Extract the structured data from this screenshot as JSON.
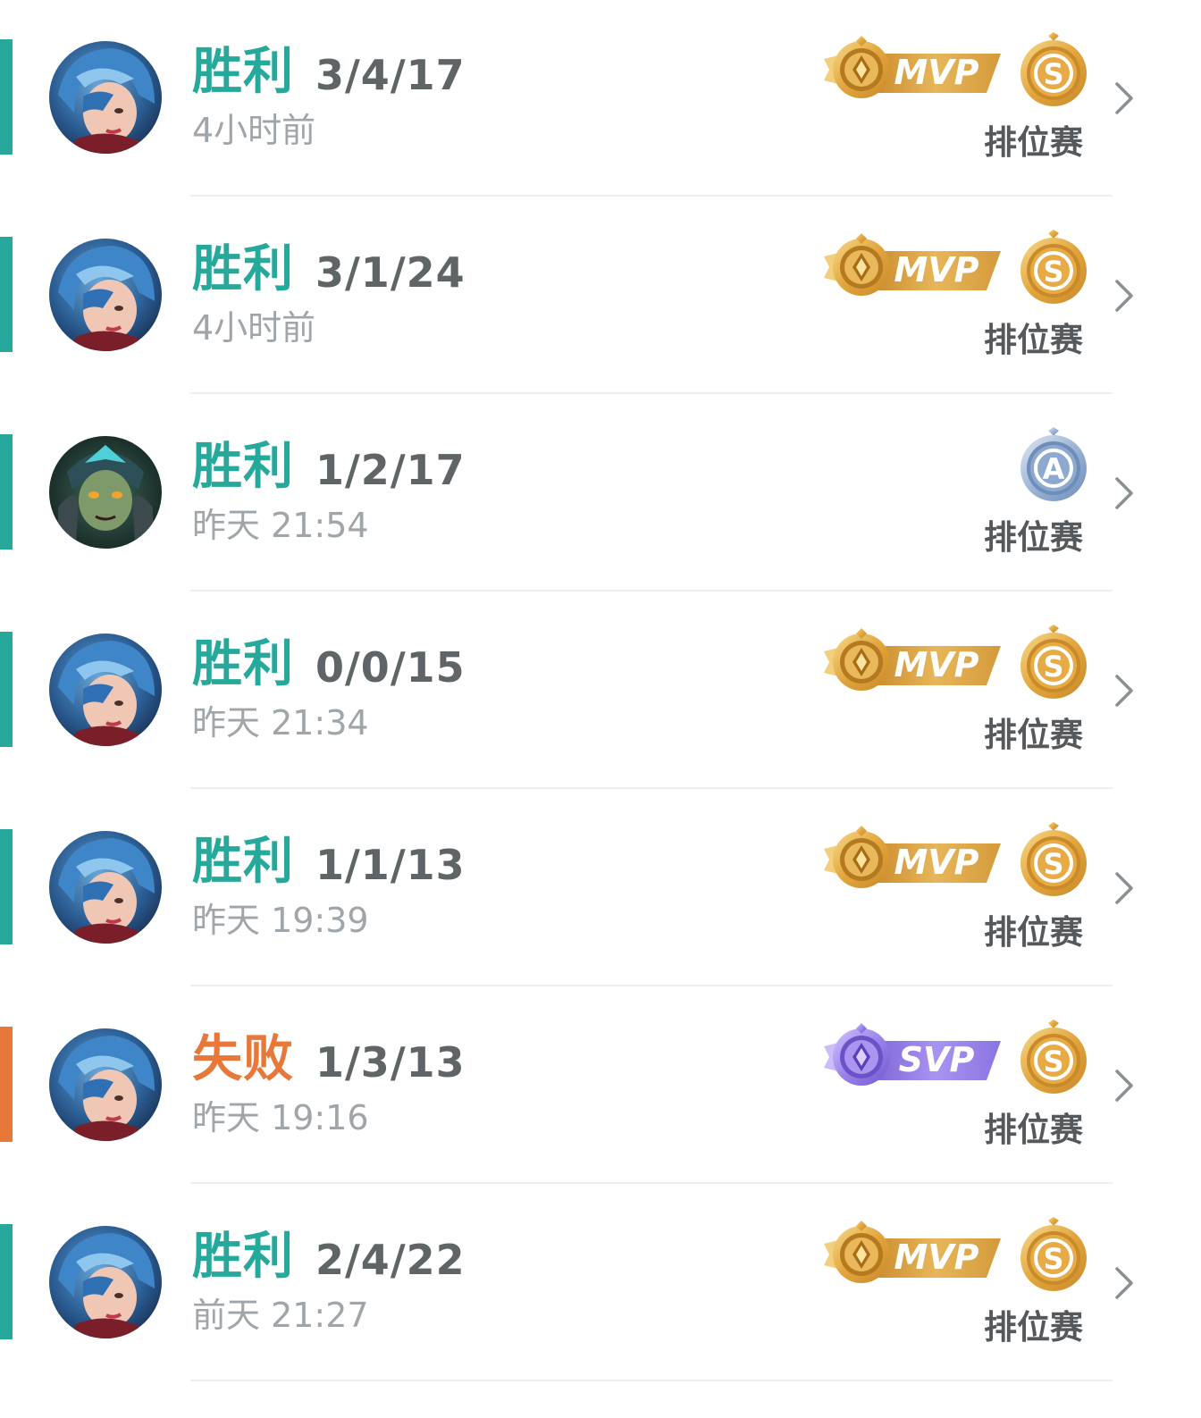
{
  "matches": [
    {
      "result": "胜利",
      "result_type": "win",
      "kda": "3/4/17",
      "time": "4小时前",
      "hero": "blue-haired-hero",
      "honor": "MVP",
      "grade": "S",
      "mode": "排位赛"
    },
    {
      "result": "胜利",
      "result_type": "win",
      "kda": "3/1/24",
      "time": "4小时前",
      "hero": "blue-haired-hero",
      "honor": "MVP",
      "grade": "S",
      "mode": "排位赛"
    },
    {
      "result": "胜利",
      "result_type": "win",
      "kda": "1/2/17",
      "time": "昨天 21:54",
      "hero": "armored-green-hero",
      "honor": "",
      "grade": "A",
      "mode": "排位赛"
    },
    {
      "result": "胜利",
      "result_type": "win",
      "kda": "0/0/15",
      "time": "昨天 21:34",
      "hero": "blue-haired-hero",
      "honor": "MVP",
      "grade": "S",
      "mode": "排位赛"
    },
    {
      "result": "胜利",
      "result_type": "win",
      "kda": "1/1/13",
      "time": "昨天 19:39",
      "hero": "blue-haired-hero",
      "honor": "MVP",
      "grade": "S",
      "mode": "排位赛"
    },
    {
      "result": "失败",
      "result_type": "loss",
      "kda": "1/3/13",
      "time": "昨天 19:16",
      "hero": "blue-haired-hero",
      "honor": "SVP",
      "grade": "S",
      "mode": "排位赛"
    },
    {
      "result": "胜利",
      "result_type": "win",
      "kda": "2/4/22",
      "time": "前天 21:27",
      "hero": "blue-haired-hero",
      "honor": "MVP",
      "grade": "S",
      "mode": "排位赛"
    }
  ],
  "colors": {
    "win": "#26a89b",
    "loss": "#e8783a",
    "kda": "#5f6466",
    "time": "#9fa5a9",
    "mode": "#55595c",
    "mvp_gold": "#d9a64a",
    "svp_purple": "#8f7ae0",
    "grade_s": "#e2a53c",
    "grade_a": "#7c9cc9"
  },
  "icons": {
    "chevron": "chevron-right-icon",
    "mvp": "mvp-badge-icon",
    "svp": "svp-badge-icon",
    "grade": "grade-medal-icon"
  }
}
